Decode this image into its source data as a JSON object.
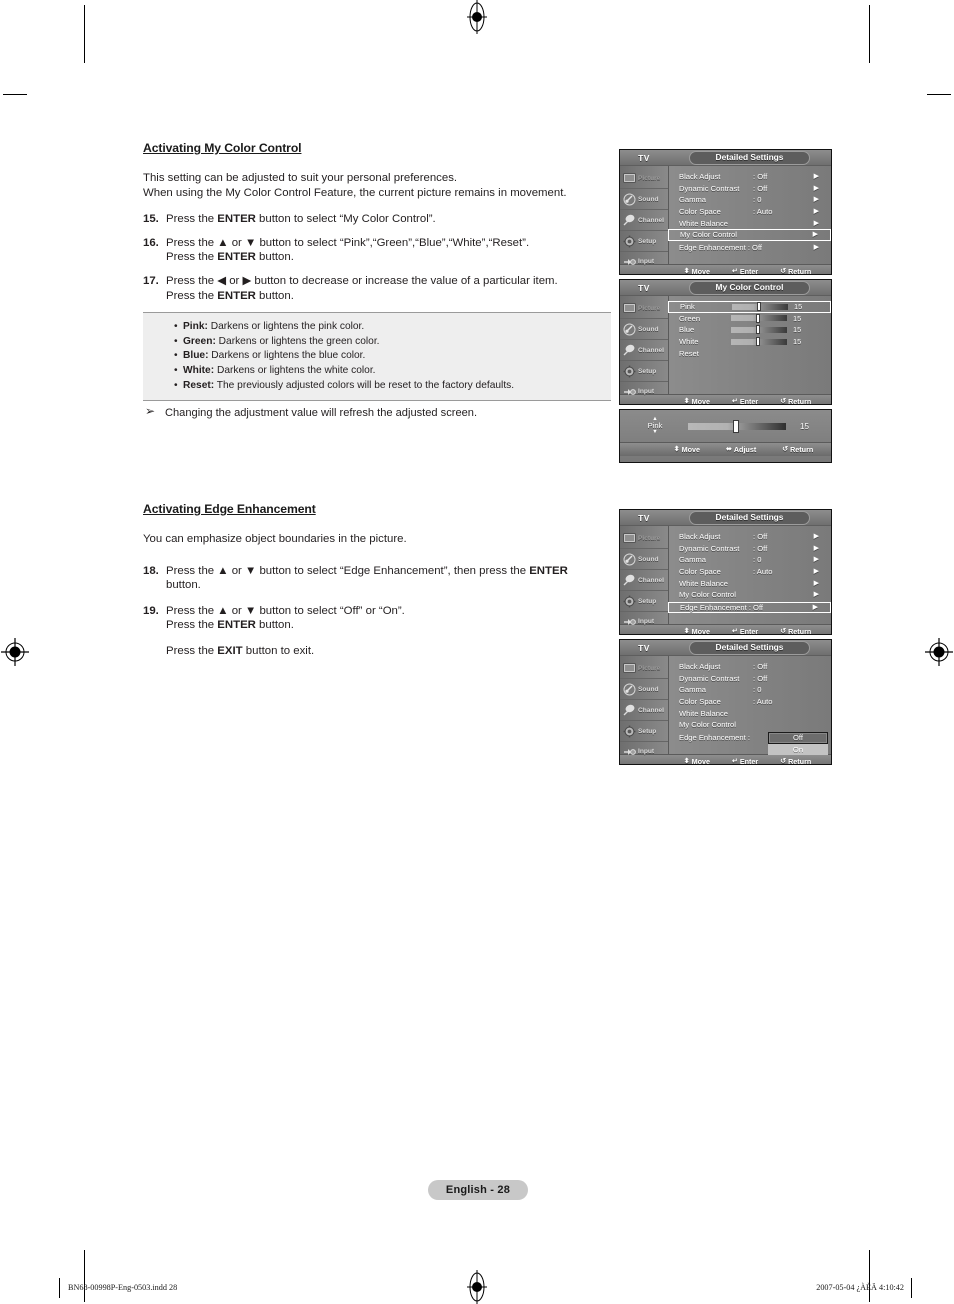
{
  "page": {
    "number_label": "English - 28",
    "footer_left": "BN68-00998P-Eng-0503.indd   28",
    "footer_right": "2007-05-04   ¿ÀÈÄ 4:10:42"
  },
  "section1": {
    "heading": "Activating My Color Control",
    "intro_line1": "This setting can be adjusted to suit your personal preferences.",
    "intro_line2": "When using the My Color Control Feature,  the current picture remains in movement.",
    "steps": [
      {
        "num": "15.",
        "pre": "Press the ",
        "bold1": "ENTER",
        "mid": " button to select “My Color Control”.",
        "line2_pre": "",
        "line2_bold": "",
        "line2_post": ""
      },
      {
        "num": "16.",
        "pre": "Press the ▲ or ▼ button to select “Pink”,“Green”,“Blue”,“White”,“Reset”.",
        "bold1": "",
        "mid": "",
        "line2_pre": "Press the ",
        "line2_bold": "ENTER",
        "line2_post": " button."
      },
      {
        "num": "17.",
        "pre": "Press the ◀ or ▶ button to decrease or increase the value of a particular item.",
        "bold1": "",
        "mid": "",
        "line2_pre": "Press the ",
        "line2_bold": "ENTER",
        "line2_post": " button."
      }
    ],
    "notes": [
      {
        "term": "Pink:",
        "text": " Darkens or lightens the pink color."
      },
      {
        "term": "Green:",
        "text": " Darkens or lightens the green color."
      },
      {
        "term": "Blue:",
        "text": " Darkens or lightens the blue color."
      },
      {
        "term": "White:",
        "text": " Darkens or lightens the white color."
      },
      {
        "term": "Reset:",
        "text": " The previously adjusted colors will be reset to the factory defaults."
      }
    ],
    "note_after": "Changing the adjustment value will refresh the adjusted screen.",
    "note_after_icon": "➢"
  },
  "section2": {
    "heading": "Activating Edge Enhancement",
    "intro_line1": "You can emphasize object boundaries in the picture.",
    "step18": {
      "num": "18.",
      "line1_pre": "Press the ▲ or ▼ button to select “Edge Enhancement”, then press the ",
      "line1_bold": "ENTER",
      "line2": "button."
    },
    "step19": {
      "num": "19.",
      "line1": "Press the ▲ or ▼ button to select “Off” or “On”.",
      "line2_pre": "Press the ",
      "line2_bold": "ENTER",
      "line2_post": " button."
    },
    "exit_pre": "Press the ",
    "exit_bold": "EXIT",
    "exit_post": " button to exit."
  },
  "osd_common": {
    "tv_label": "TV",
    "sidebar": [
      {
        "label": "Picture",
        "icon": "picture-icon",
        "dim": true
      },
      {
        "label": "Sound",
        "icon": "sound-icon",
        "dim": false
      },
      {
        "label": "Channel",
        "icon": "channel-icon",
        "dim": false
      },
      {
        "label": "Setup",
        "icon": "setup-icon",
        "dim": false
      },
      {
        "label": "Input",
        "icon": "input-icon",
        "dim": false
      }
    ],
    "footer_move": "Move",
    "footer_enter": "Enter",
    "footer_return": "Return",
    "footer_adjust": "Adjust",
    "arrow_glyph": "▶",
    "move_glyph": "⬍",
    "enter_glyph": "↵",
    "return_glyph": "↺",
    "adjust_glyph": "⬌"
  },
  "panel1": {
    "title": "Detailed Settings",
    "rows": [
      {
        "label": "Black Adjust",
        "value": ": Off",
        "arrow": "▶",
        "selected": false
      },
      {
        "label": "Dynamic Contrast",
        "value": ": Off",
        "arrow": "▶",
        "selected": false
      },
      {
        "label": "Gamma",
        "value": ": 0",
        "arrow": "▶",
        "selected": false
      },
      {
        "label": "Color Space",
        "value": ": Auto",
        "arrow": "▶",
        "selected": false
      },
      {
        "label": "White Balance",
        "value": "",
        "arrow": "▶",
        "selected": false
      },
      {
        "label": "My Color Control",
        "value": "",
        "arrow": "▶",
        "selected": true
      },
      {
        "label": "Edge Enhancement : Off",
        "value": "",
        "arrow": "▶",
        "selected": false
      }
    ]
  },
  "panel2": {
    "title": "My Color Control",
    "rows": [
      {
        "label": "Pink",
        "value": "15",
        "knob_pct": 46,
        "selected": true,
        "slider": true
      },
      {
        "label": "Green",
        "value": "15",
        "knob_pct": 46,
        "selected": false,
        "slider": true
      },
      {
        "label": "Blue",
        "value": "15",
        "knob_pct": 46,
        "selected": false,
        "slider": true
      },
      {
        "label": "White",
        "value": "15",
        "knob_pct": 46,
        "selected": false,
        "slider": true
      },
      {
        "label": "Reset",
        "value": "",
        "knob_pct": 0,
        "selected": false,
        "slider": false
      }
    ]
  },
  "panel3_adjust": {
    "item_label": "Pink",
    "value": "15",
    "knob_pct": 47,
    "up_glyph": "▲",
    "down_glyph": "▼"
  },
  "panel4": {
    "title": "Detailed Settings",
    "rows": [
      {
        "label": "Black Adjust",
        "value": ": Off",
        "arrow": "▶",
        "selected": false
      },
      {
        "label": "Dynamic Contrast",
        "value": ": Off",
        "arrow": "▶",
        "selected": false
      },
      {
        "label": "Gamma",
        "value": ": 0",
        "arrow": "▶",
        "selected": false
      },
      {
        "label": "Color Space",
        "value": ": Auto",
        "arrow": "▶",
        "selected": false
      },
      {
        "label": "White Balance",
        "value": "",
        "arrow": "▶",
        "selected": false
      },
      {
        "label": "My Color Control",
        "value": "",
        "arrow": "▶",
        "selected": false
      },
      {
        "label": "Edge Enhancement : Off",
        "value": "",
        "arrow": "▶",
        "selected": true
      }
    ]
  },
  "panel5": {
    "title": "Detailed Settings",
    "rows": [
      {
        "label": "Black Adjust",
        "value": ": Off",
        "selected": false
      },
      {
        "label": "Dynamic Contrast",
        "value": ": Off",
        "selected": false
      },
      {
        "label": "Gamma",
        "value": ": 0",
        "selected": false
      },
      {
        "label": "Color Space",
        "value": ": Auto",
        "selected": false
      },
      {
        "label": "White Balance",
        "value": "",
        "selected": false
      },
      {
        "label": "My Color Control",
        "value": "",
        "selected": false
      },
      {
        "label": "Edge Enhancement :",
        "value": "",
        "selected": false
      }
    ],
    "dropdown": {
      "selected": "Off",
      "other": "On"
    }
  }
}
